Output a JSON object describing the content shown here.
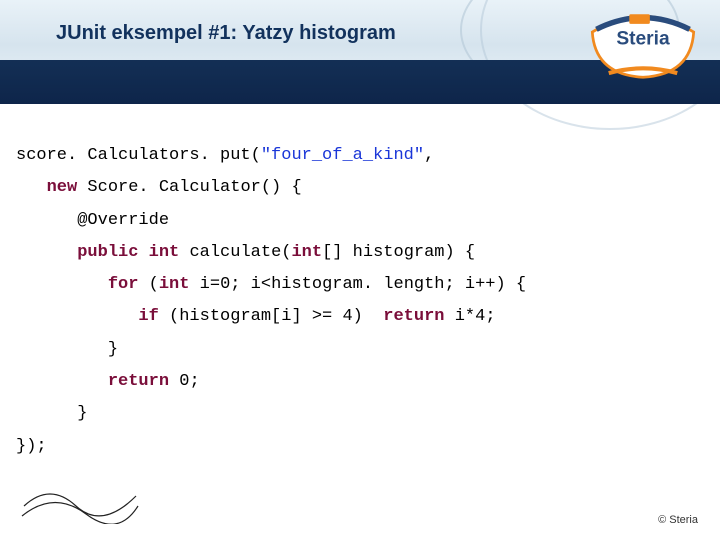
{
  "header": {
    "title": "JUnit eksempel #1: Yatzy histogram",
    "logo_text": "Steria"
  },
  "code": {
    "lines": [
      {
        "segments": [
          {
            "t": "score. Calculators. put("
          },
          {
            "t": "\"four_of_a_kind\"",
            "cls": "str"
          },
          {
            "t": ","
          }
        ]
      },
      {
        "indent": 1,
        "segments": [
          {
            "t": "new",
            "cls": "kw"
          },
          {
            "t": " Score. Calculator() {"
          }
        ]
      },
      {
        "indent": 2,
        "segments": [
          {
            "t": "@Override"
          }
        ]
      },
      {
        "indent": 2,
        "segments": [
          {
            "t": "public int",
            "cls": "kw"
          },
          {
            "t": " calculate("
          },
          {
            "t": "int",
            "cls": "kw"
          },
          {
            "t": "[] histogram) {"
          }
        ]
      },
      {
        "indent": 3,
        "segments": [
          {
            "t": "for",
            "cls": "kw"
          },
          {
            "t": " ("
          },
          {
            "t": "int",
            "cls": "kw"
          },
          {
            "t": " i="
          },
          {
            "t": "0",
            "cls": "num"
          },
          {
            "t": "; i<histogram. length; i++) {"
          }
        ]
      },
      {
        "indent": 4,
        "segments": [
          {
            "t": "if",
            "cls": "kw"
          },
          {
            "t": " (histogram[i] >= "
          },
          {
            "t": "4",
            "cls": "num"
          },
          {
            "t": ")  "
          },
          {
            "t": "return",
            "cls": "kw"
          },
          {
            "t": " i*"
          },
          {
            "t": "4",
            "cls": "num"
          },
          {
            "t": ";"
          }
        ]
      },
      {
        "indent": 3,
        "segments": [
          {
            "t": "}"
          }
        ]
      },
      {
        "indent": 3,
        "segments": [
          {
            "t": "return",
            "cls": "kw"
          },
          {
            "t": " "
          },
          {
            "t": "0",
            "cls": "num"
          },
          {
            "t": ";"
          }
        ]
      },
      {
        "indent": 2,
        "segments": [
          {
            "t": "}"
          }
        ]
      },
      {
        "indent": 0,
        "segments": [
          {
            "t": "});"
          }
        ]
      }
    ]
  },
  "footer": {
    "copyright": "© Steria"
  }
}
